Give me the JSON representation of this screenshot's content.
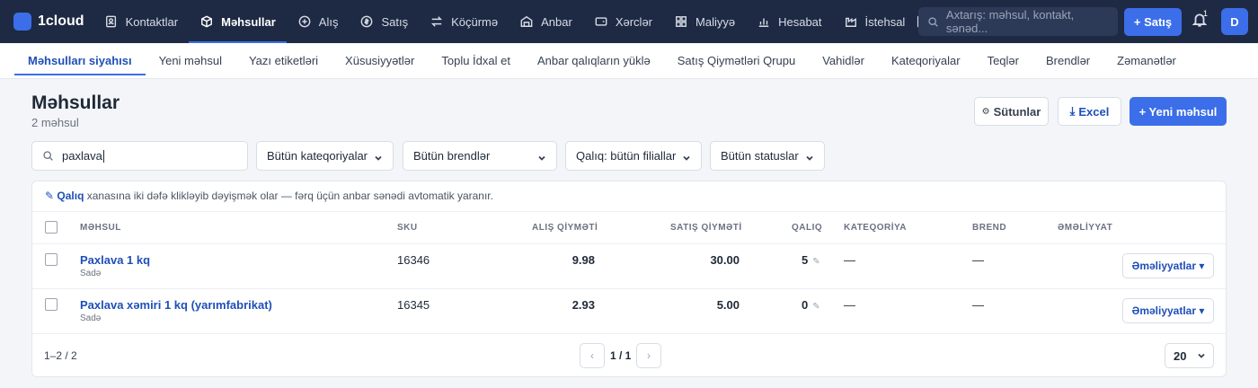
{
  "app": {
    "logo_text": "1cloud",
    "brand_color": "#3b6ee8",
    "topbar_color": "#1e2a44"
  },
  "nav": [
    {
      "label": "Kontaktlar",
      "icon": "contacts-icon"
    },
    {
      "label": "Məhsullar",
      "icon": "box-icon",
      "active": true
    },
    {
      "label": "Alış",
      "icon": "plus-circle-icon"
    },
    {
      "label": "Satış",
      "icon": "dollar-icon"
    },
    {
      "label": "Köçürmə",
      "icon": "transfer-icon"
    },
    {
      "label": "Anbar",
      "icon": "warehouse-icon"
    },
    {
      "label": "Xərclər",
      "icon": "wallet-icon"
    },
    {
      "label": "Maliyyə",
      "icon": "grid-icon"
    },
    {
      "label": "Hesabat",
      "icon": "bar-chart-icon"
    },
    {
      "label": "İstehsal",
      "icon": "factory-icon"
    }
  ],
  "search": {
    "placeholder": "Axtarış: məhsul, kontakt, sənəd..."
  },
  "sale_button": "+ Satış",
  "notifications": {
    "count": "1"
  },
  "avatar": {
    "initial": "D"
  },
  "subnav": [
    {
      "label": "Məhsulları siyahısı",
      "active": true
    },
    {
      "label": "Yeni məhsul"
    },
    {
      "label": "Yazı etiketləri"
    },
    {
      "label": "Xüsusiyyətlər"
    },
    {
      "label": "Toplu İdxal et"
    },
    {
      "label": "Anbar qalıqların yüklə"
    },
    {
      "label": "Satış Qiymətləri Qrupu"
    },
    {
      "label": "Vahidlər"
    },
    {
      "label": "Kateqoriyalar"
    },
    {
      "label": "Teqlər"
    },
    {
      "label": "Brendlər"
    },
    {
      "label": "Zəmanətlər"
    }
  ],
  "header": {
    "title": "Məhsullar",
    "subtitle": "2 məhsul",
    "columns_button": "Sütunlar",
    "excel_button": "Excel",
    "new_button": "+ Yeni məhsul"
  },
  "filters": {
    "search_value": "paxlava",
    "category": "Bütün kateqoriyalar",
    "brand": "Bütün brendlər",
    "stock": "Qalıq: bütün filiallar",
    "status": "Bütün statuslar"
  },
  "hint": {
    "bold": "✎ Qalıq",
    "text": "xanasına iki dəfə klikləyib dəyişmək olar — fərq üçün anbar sənədi avtomatik yaranır."
  },
  "table": {
    "headers": {
      "product": "MƏHSUL",
      "sku": "SKU",
      "purchase": "ALIŞ QİYMƏTİ",
      "sale": "SATIŞ QİYMƏTİ",
      "stock": "QALIQ",
      "category": "KATEQORİYA",
      "brand": "BREND",
      "actions": "ƏMƏLİYYAT"
    },
    "rows": [
      {
        "name": "Paxlava 1 kq",
        "type": "Sadə",
        "sku": "16346",
        "purchase": "9.98",
        "sale": "30.00",
        "stock": "5",
        "category": "—",
        "brand": "—",
        "actions": "Əməliyyatlar ▾"
      },
      {
        "name": "Paxlava xəmiri 1 kq (yarımfabrikat)",
        "type": "Sadə",
        "sku": "16345",
        "purchase": "2.93",
        "sale": "5.00",
        "stock": "0",
        "category": "—",
        "brand": "—",
        "actions": "Əməliyyatlar ▾"
      }
    ]
  },
  "pagination": {
    "range": "1–2 / 2",
    "pages": "1 / 1",
    "per_page": "20"
  }
}
